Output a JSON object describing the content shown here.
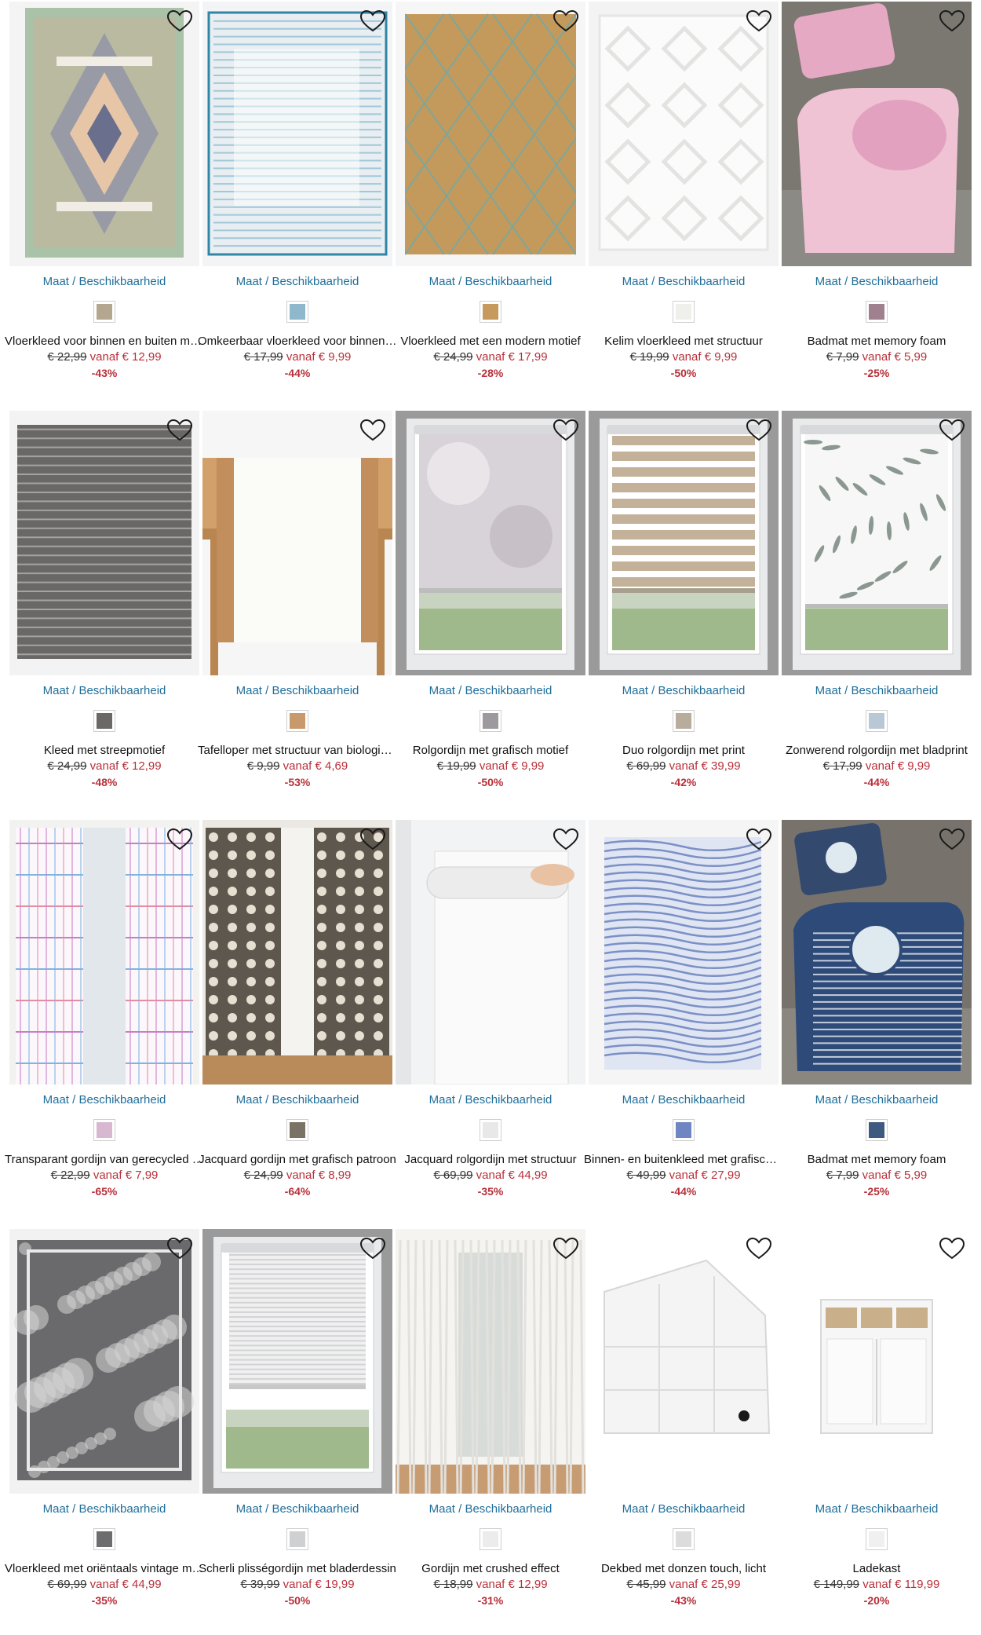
{
  "common": {
    "size_label": "Maat / Beschikbaarheid",
    "vanaf": "vanaf",
    "wishlist_icon": "heart-outline-icon"
  },
  "colors": {
    "link": "#1f6e9a",
    "sale": "#b8303a",
    "text": "#111111"
  },
  "products": [
    {
      "title": "Vloerkleed voor binnen en buiten met etnisch patroon",
      "old": "€ 22,99",
      "new": "€ 12,99",
      "discount": "-43%",
      "image": "pastel-ethnic-rug",
      "swatch": "#b5a78f"
    },
    {
      "title": "Omkeerbaar vloerkleed voor binnen en buiten",
      "old": "€ 17,99",
      "new": "€ 9,99",
      "discount": "-44%",
      "image": "blue-white-rug",
      "swatch": "#8fb8cc"
    },
    {
      "title": "Vloerkleed met een modern motief",
      "old": "€ 24,99",
      "new": "€ 17,99",
      "discount": "-28%",
      "image": "jute-diamond-rug",
      "swatch": "#c59a5c"
    },
    {
      "title": "Kelim vloerkleed met structuur",
      "old": "€ 19,99",
      "new": "€ 9,99",
      "discount": "-50%",
      "image": "white-kelim-rug",
      "swatch": "#efefec"
    },
    {
      "title": "Badmat met memory foam",
      "old": "€ 7,99",
      "new": "€ 5,99",
      "discount": "-25%",
      "image": "pink-bathmat",
      "swatch": "#a07f8f"
    },
    {
      "title": "Kleed met streepmotief",
      "old": "€ 24,99",
      "new": "€ 12,99",
      "discount": "-48%",
      "image": "grey-striped-rug",
      "swatch": "#6b6868"
    },
    {
      "title": "Tafelloper met structuur van biologisch katoen",
      "old": "€ 9,99",
      "new": "€ 4,69",
      "discount": "-53%",
      "image": "table-runner",
      "swatch": "#c89a6b"
    },
    {
      "title": "Rolgordijn met grafisch motief",
      "old": "€ 19,99",
      "new": "€ 9,99",
      "discount": "-50%",
      "image": "graphic-roller-blind",
      "swatch": "#9c9a9e"
    },
    {
      "title": "Duo rolgordijn met print",
      "old": "€ 69,99",
      "new": "€ 39,99",
      "discount": "-42%",
      "image": "duo-roller-blind",
      "swatch": "#b8ad9c"
    },
    {
      "title": "Zonwerend rolgordijn met bladprint",
      "old": "€ 17,99",
      "new": "€ 9,99",
      "discount": "-44%",
      "image": "leaf-roller-blind",
      "swatch": "#b9c8d4"
    },
    {
      "title": "Transparant gordijn van gerecycled polyester",
      "old": "€ 22,99",
      "new": "€ 7,99",
      "discount": "-65%",
      "image": "check-curtains",
      "swatch": "#d8b8d0"
    },
    {
      "title": "Jacquard gordijn met grafisch patroon",
      "old": "€ 24,99",
      "new": "€ 8,99",
      "discount": "-64%",
      "image": "jacquard-curtains",
      "swatch": "#7a7264"
    },
    {
      "title": "Jacquard rolgordijn met structuur",
      "old": "€ 69,99",
      "new": "€ 44,99",
      "discount": "-35%",
      "image": "white-roller-blind",
      "swatch": "#e8e8e8"
    },
    {
      "title": "Binnen- en buitenkleed met grafisch patroon",
      "old": "€ 49,99",
      "new": "€ 27,99",
      "discount": "-44%",
      "image": "blue-graphic-rug",
      "swatch": "#6f86c2"
    },
    {
      "title": "Badmat met memory foam",
      "old": "€ 7,99",
      "new": "€ 5,99",
      "discount": "-25%",
      "image": "anchor-bathmat",
      "swatch": "#3f5a80"
    },
    {
      "title": "Vloerkleed met oriëntaals vintage motief",
      "old": "€ 69,99",
      "new": "€ 44,99",
      "discount": "-35%",
      "image": "grey-oriental-rug",
      "swatch": "#6d6d70"
    },
    {
      "title": "Scherli plisségordijn met bladerdessin",
      "old": "€ 39,99",
      "new": "€ 19,99",
      "discount": "-50%",
      "image": "pleated-blind",
      "swatch": "#cfd0d2"
    },
    {
      "title": "Gordijn met crushed effect",
      "old": "€ 18,99",
      "new": "€ 12,99",
      "discount": "-31%",
      "image": "white-crushed-curtain",
      "swatch": "#ececec"
    },
    {
      "title": "Dekbed met donzen touch, licht",
      "old": "€ 45,99",
      "new": "€ 25,99",
      "discount": "-43%",
      "image": "duvet",
      "swatch": "#dcdcdc"
    },
    {
      "title": "Ladekast",
      "old": "€ 149,99",
      "new": "€ 119,99",
      "discount": "-20%",
      "image": "white-cabinet",
      "swatch": "#f0f0f0"
    }
  ]
}
